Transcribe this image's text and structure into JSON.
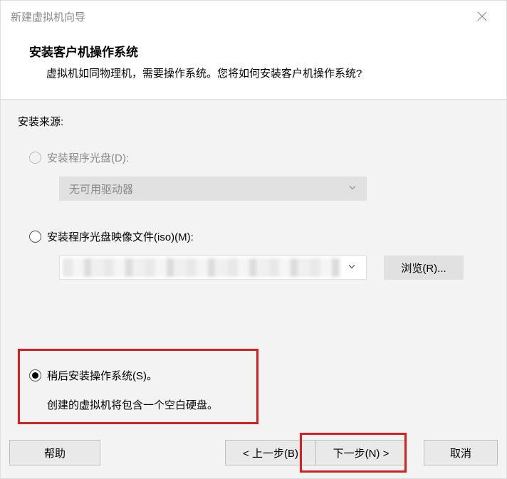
{
  "window": {
    "title": "新建虚拟机向导"
  },
  "header": {
    "title": "安装客户机操作系统",
    "subtitle": "虚拟机如同物理机，需要操作系统。您将如何安装客户机操作系统?"
  },
  "source": {
    "label": "安装来源:",
    "options": {
      "disc": {
        "label": "安装程序光盘(D):",
        "dropdown_text": "无可用驱动器"
      },
      "iso": {
        "label": "安装程序光盘映像文件(iso)(M):",
        "browse_label": "浏览(R)..."
      },
      "later": {
        "label": "稍后安装操作系统(S)。",
        "description": "创建的虚拟机将包含一个空白硬盘。"
      }
    }
  },
  "buttons": {
    "help": "帮助",
    "back": "< 上一步(B)",
    "next": "下一步(N) >",
    "cancel": "取消"
  }
}
